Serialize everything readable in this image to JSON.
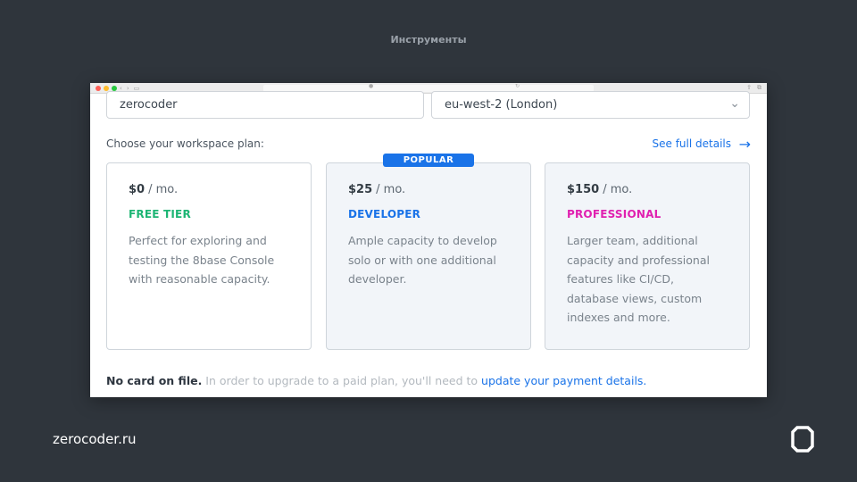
{
  "slide": {
    "header": "Инструменты",
    "footer_url": "zerocoder.ru"
  },
  "browser": {
    "lock_icon": "lock-icon",
    "reload_icon": "reload-icon"
  },
  "form": {
    "workspace_name": "zerocoder",
    "region": "eu-west-2 (London)",
    "plan_label": "Choose your workspace plan:",
    "details_link": "See full details"
  },
  "plans": [
    {
      "price": "$0",
      "period": "/ mo.",
      "tier": "FREE TIER",
      "tier_color": "#1db574",
      "description": "Perfect for exploring and testing the 8base Console with reasonable capacity."
    },
    {
      "price": "$25",
      "period": "/ mo.",
      "tier": "DEVELOPER",
      "tier_color": "#1a73e8",
      "badge": "POPULAR",
      "description": "Ample capacity to develop solo or with one additional developer."
    },
    {
      "price": "$150",
      "period": "/ mo.",
      "tier": "PROFESSIONAL",
      "tier_color": "#e020b0",
      "description": "Larger team, additional capacity and professional features like CI/CD, database views, custom indexes and more."
    }
  ],
  "note": {
    "bold": "No card on file.",
    "text": " In order to upgrade to a paid plan, you'll need to ",
    "link": "update your payment details."
  },
  "colors": {
    "accent": "#1a73e8",
    "background": "#2f353c"
  }
}
